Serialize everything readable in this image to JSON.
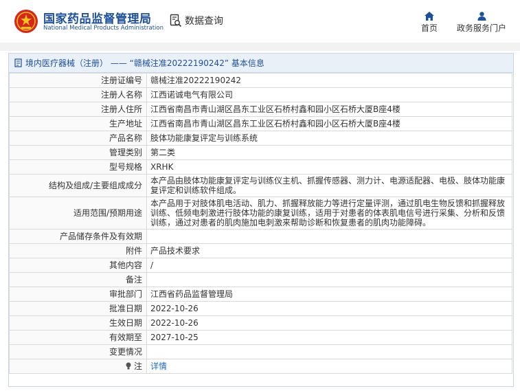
{
  "header": {
    "brand_cn": "国家药品监督管理局",
    "brand_en": "National Medical Products Administration",
    "data_query": "数据查询",
    "nav_home": "首页",
    "nav_portal": "政务服务门户",
    "accent": "#1c4f9c"
  },
  "panel": {
    "title": "境内医疗器械（注册） —— “赣械注准20222190242” 基本信息"
  },
  "rows": [
    {
      "label": "注册证编号",
      "value": "赣械注准20222190242"
    },
    {
      "label": "注册人名称",
      "value": "江西诺诚电气有限公司"
    },
    {
      "label": "注册人住所",
      "value": "江西省南昌市青山湖区昌东工业区石桥村鑫和园小区石桥大厦B座4楼"
    },
    {
      "label": "生产地址",
      "value": "江西省南昌市青山湖区昌东工业区石桥村鑫和园小区石桥大厦B座4楼"
    },
    {
      "label": "产品名称",
      "value": "肢体功能康复评定与训练系统"
    },
    {
      "label": "管理类别",
      "value": "第二类"
    },
    {
      "label": "型号规格",
      "value": "XRHK"
    },
    {
      "label": "结构及组成/主要组成成分",
      "value": "本产品由肢体功能康复评定与训练仪主机、抓握传感器、测力计、电源适配器、电极、肢体功能康复评定和训练软件组成。"
    },
    {
      "label": "适用范围/预期用途",
      "value": "本产品用于对肢体肌电活动、肌力、抓握释放能力等进行定量评测，通过肌电生物反馈和抓握释放训练、低频电刺激进行肢体功能的康复训练，适用于对患者的体表肌电信号进行采集、分析和反馈训练，通过对患者的肌肉施加电刺激来帮助诊断和恢复患者的肌肉功能障碍。"
    },
    {
      "label": "产品储存条件及有效期",
      "value": ""
    },
    {
      "label": "附件",
      "value": "产品技术要求"
    },
    {
      "label": "其他内容",
      "value": "/"
    },
    {
      "label": "备注",
      "value": ""
    },
    {
      "label": "审批部门",
      "value": "江西省药品监督管理局"
    },
    {
      "label": "批准日期",
      "value": "2022-10-26"
    },
    {
      "label": "生效日期",
      "value": "2022-10-26"
    },
    {
      "label": "有效期至",
      "value": "2027-10-25"
    },
    {
      "label": "变更情况",
      "value": ""
    },
    {
      "label": "注",
      "value": "详情"
    }
  ]
}
